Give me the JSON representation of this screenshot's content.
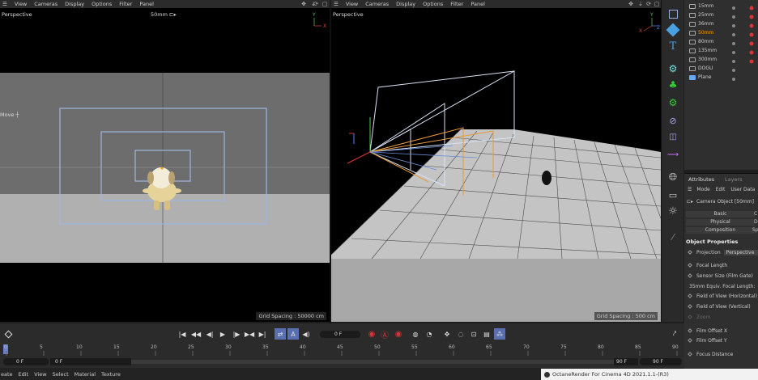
{
  "menubar_left": {
    "items": [
      "View",
      "Cameras",
      "Display",
      "Options",
      "Filter",
      "Panel"
    ]
  },
  "menubar_right": {
    "items": [
      "View",
      "Cameras",
      "Display",
      "Options",
      "Filter",
      "Panel"
    ]
  },
  "viewport_left": {
    "label": "Perspective",
    "camera_label": "50mm",
    "move_label": "Move"
  },
  "viewport_right": {
    "label": "Perspective",
    "grid_spacing": "Grid Spacing : 500 cm"
  },
  "grid_spacing_left": "Grid Spacing : 50000 cm",
  "object_manager": {
    "items": [
      {
        "name": "15mm",
        "highlight": false
      },
      {
        "name": "25mm",
        "highlight": false
      },
      {
        "name": "36mm",
        "highlight": false
      },
      {
        "name": "50mm",
        "highlight": true
      },
      {
        "name": "80mm",
        "highlight": false
      },
      {
        "name": "135mm",
        "highlight": false
      },
      {
        "name": "300mm",
        "highlight": false
      },
      {
        "name": "DOGU",
        "highlight": false
      },
      {
        "name": "Plane",
        "highlight": false
      }
    ]
  },
  "attributes": {
    "tabs": [
      "Attributes",
      "Layers"
    ],
    "menu": [
      "Mode",
      "Edit",
      "User Data"
    ],
    "object_title": "Camera Object [50mm]",
    "subtabs": [
      "Basic",
      "Physical",
      "Composition"
    ],
    "subtabs_right": [
      "C",
      "D",
      "Sp"
    ],
    "section": "Object Properties",
    "projection_label": "Projection",
    "projection_value": "Perspective",
    "properties": [
      "Focal Length",
      "Sensor Size (Film Gate)",
      "35mm Equiv. Focal Length:",
      "Field of View (Horizontal)",
      "Field of View (Vertical)",
      "Zoom",
      "Film Offset X",
      "Film Offset Y",
      "Focus Distance"
    ]
  },
  "timeline": {
    "current_frame": "0 F",
    "start_field": "0 F",
    "start_field2": "0 F",
    "end_field": "90 F",
    "end_field2": "90 F",
    "ruler": [
      "0",
      "5",
      "10",
      "15",
      "20",
      "25",
      "30",
      "35",
      "40",
      "45",
      "50",
      "55",
      "60",
      "65",
      "70",
      "75",
      "80",
      "85",
      "90"
    ]
  },
  "bottom_menu": {
    "items": [
      "eate",
      "Edit",
      "View",
      "Select",
      "Material",
      "Texture"
    ]
  },
  "octane_label": "OctaneRender For Cinema 4D 2021.1.1-(R3)",
  "colors": {
    "accent": "#f0a000",
    "selection": "#5a6fb0",
    "record": "#d33"
  }
}
